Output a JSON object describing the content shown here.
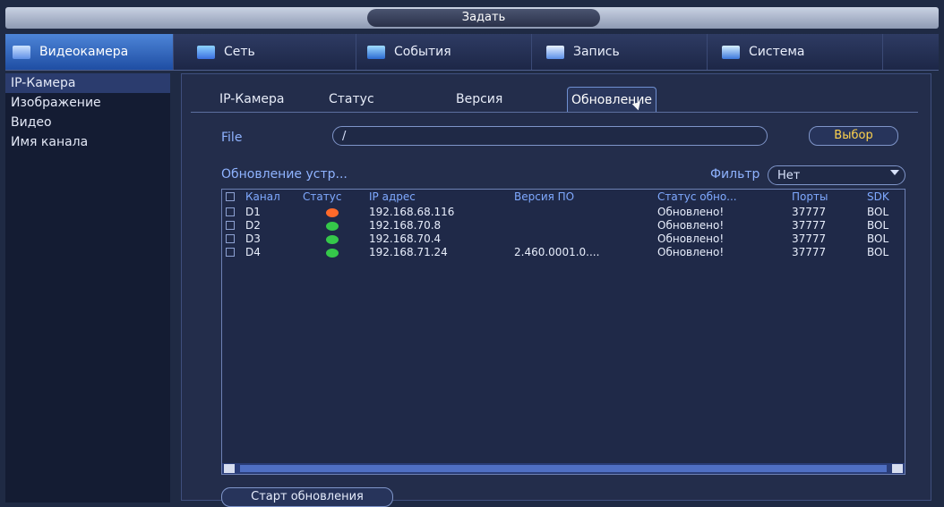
{
  "window": {
    "title": "Задать"
  },
  "top_nav": [
    {
      "label": "Видеокамера",
      "icon": "camera-icon",
      "active": true
    },
    {
      "label": "Сеть",
      "icon": "network-icon",
      "active": false
    },
    {
      "label": "События",
      "icon": "events-icon",
      "active": false
    },
    {
      "label": "Запись",
      "icon": "record-icon",
      "active": false
    },
    {
      "label": "Система",
      "icon": "system-icon",
      "active": false
    }
  ],
  "sidebar": {
    "items": [
      {
        "label": "IP-Камера",
        "active": true
      },
      {
        "label": "Изображение",
        "active": false
      },
      {
        "label": "Видео",
        "active": false
      },
      {
        "label": "Имя канала",
        "active": false
      }
    ]
  },
  "tabs": [
    {
      "label": "IP-Камера"
    },
    {
      "label": "Статус"
    },
    {
      "label": "Версия"
    },
    {
      "label": "Обновление",
      "active": true
    }
  ],
  "file": {
    "label": "File",
    "value": "/"
  },
  "buttons": {
    "select": "Выбор",
    "start_update": "Старт обновления"
  },
  "section": {
    "title": "Обновление устр..."
  },
  "filter": {
    "label": "Фильтр",
    "value": "Нет"
  },
  "table": {
    "headers": [
      "Канал",
      "Статус",
      "IP адрес",
      "Версия ПО",
      "Статус обно...",
      "Порты",
      "SDK"
    ],
    "rows": [
      {
        "channel": "D1",
        "status_color": "#ff6a2a",
        "ip": "192.168.68.116",
        "version": "",
        "update_status": "Обновлено!",
        "port": "37777",
        "sdk": "BOL"
      },
      {
        "channel": "D2",
        "status_color": "#35c84a",
        "ip": "192.168.70.8",
        "version": "",
        "update_status": "Обновлено!",
        "port": "37777",
        "sdk": "BOL"
      },
      {
        "channel": "D3",
        "status_color": "#35c84a",
        "ip": "192.168.70.4",
        "version": "",
        "update_status": "Обновлено!",
        "port": "37777",
        "sdk": "BOL"
      },
      {
        "channel": "D4",
        "status_color": "#35c84a",
        "ip": "192.168.71.24",
        "version": "2.460.0001.0....",
        "update_status": "Обновлено!",
        "port": "37777",
        "sdk": "BOL"
      }
    ]
  },
  "colors": {
    "accent": "#4d85d8",
    "highlight": "#8fb3ff",
    "online": "#35c84a",
    "offline": "#ff6a2a"
  }
}
